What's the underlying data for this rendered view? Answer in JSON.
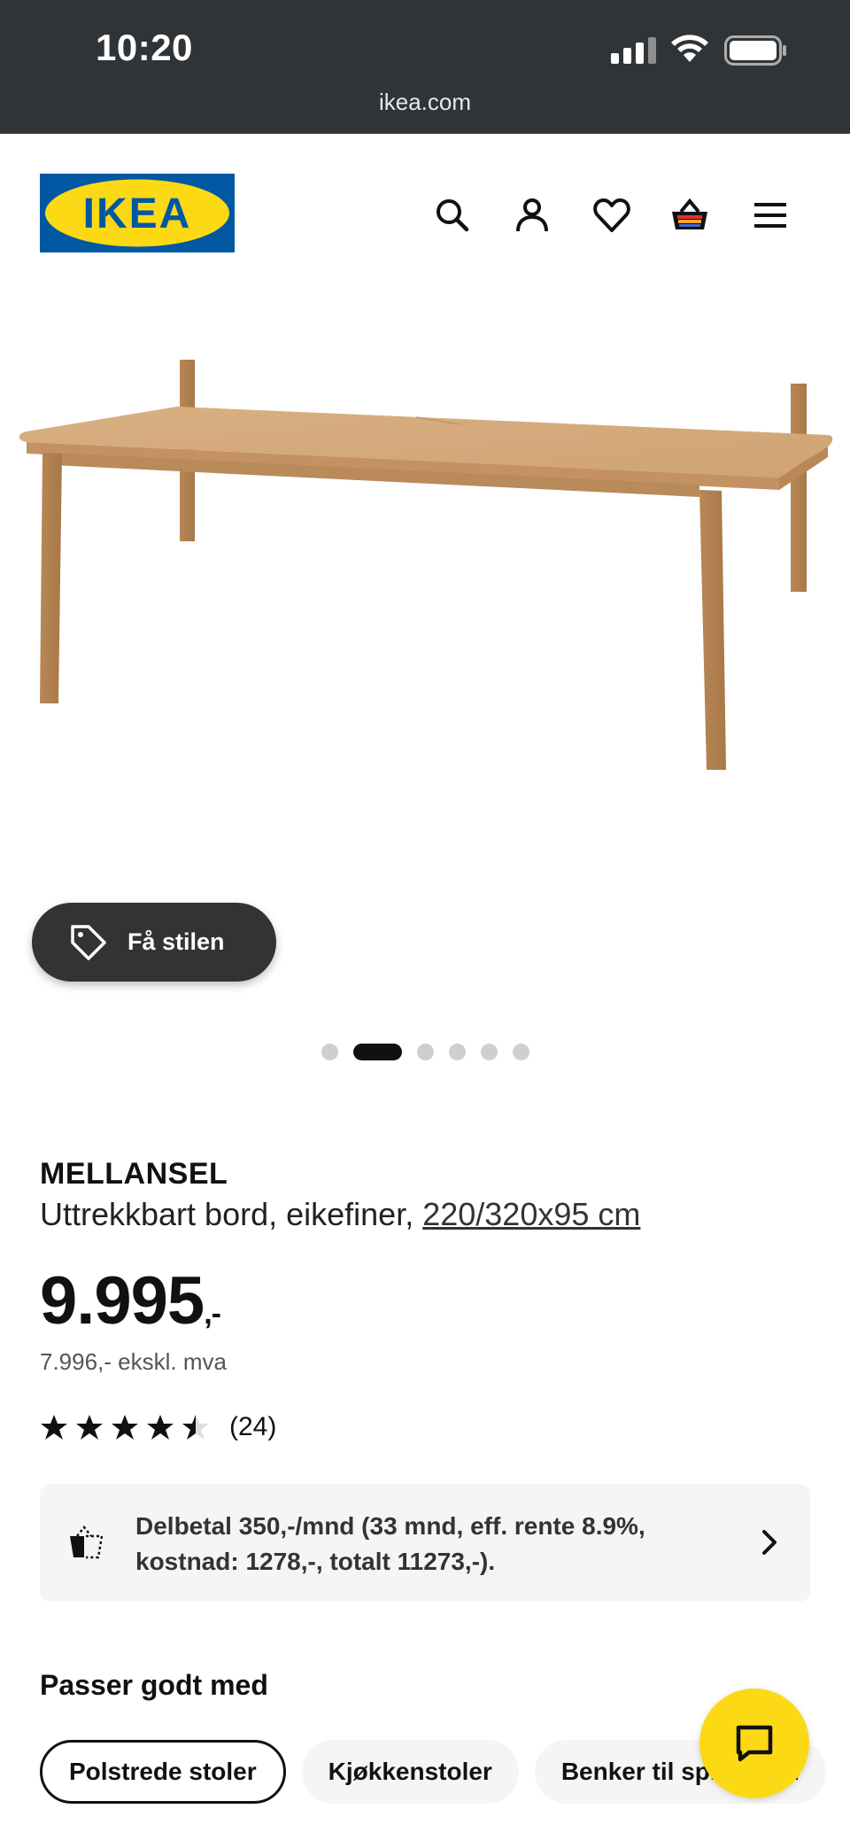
{
  "status_bar": {
    "time": "10:20",
    "url": "ikea.com"
  },
  "header": {
    "logo_text": "IKEA",
    "icons": [
      "search-icon",
      "account-icon",
      "heart-icon",
      "cart-icon",
      "menu-icon"
    ]
  },
  "gallery": {
    "style_button_label": "Få stilen",
    "dot_count": 6,
    "active_dot": 1
  },
  "product": {
    "name": "MELLANSEL",
    "description": "Uttrekkbart bord, eikefiner,",
    "size": "220/320x95 cm",
    "price": "9.995",
    "price_suffix": ",-",
    "price_ex_vat": "7.996,- ekskl. mva",
    "rating": 4.5,
    "rating_count": "(24)"
  },
  "finance": {
    "text": "Delbetal 350,-/mnd (33 mnd, eff. rente 8.9%, kostnad: 1278,-, totalt 11273,-)."
  },
  "fits_with": {
    "title": "Passer godt med",
    "chips": [
      "Polstrede stoler",
      "Kjøkkenstoler",
      "Benker til spisebord"
    ]
  },
  "colors": {
    "ikea_blue": "#0058a3",
    "ikea_yellow": "#fbd914",
    "status_bar": "#313437"
  }
}
